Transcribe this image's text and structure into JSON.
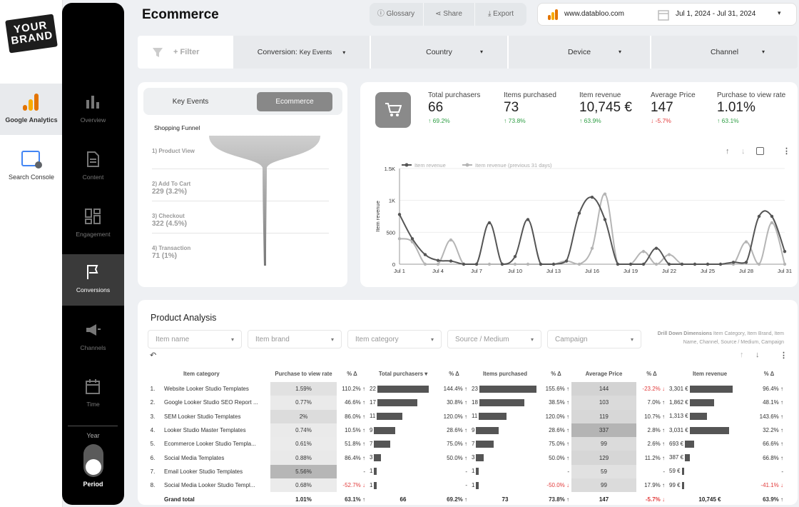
{
  "sources": [
    {
      "label": "Google Analytics",
      "icon": "google-analytics-icon"
    },
    {
      "label": "Search Console",
      "icon": "search-console-icon"
    }
  ],
  "brand": {
    "line1": "YOUR",
    "line2": "BRAND"
  },
  "nav": [
    {
      "label": "Overview",
      "icon": "bar-chart-icon"
    },
    {
      "label": "Content",
      "icon": "document-icon"
    },
    {
      "label": "Engagement",
      "icon": "dashboard-icon"
    },
    {
      "label": "Conversions",
      "icon": "flag-icon"
    },
    {
      "label": "Channels",
      "icon": "megaphone-icon"
    },
    {
      "label": "Time",
      "icon": "calendar-icon"
    }
  ],
  "year_label": "Year",
  "period_label": "Period",
  "page_title": "Ecommerce",
  "toolbar": {
    "glossary": "Glossary",
    "share": "Share",
    "export": "Export"
  },
  "site": "www.databloo.com",
  "date_range": "Jul 1, 2024 - Jul 31, 2024",
  "filters": {
    "add": "+ Filter",
    "conversion": "Conversion:",
    "conversion_value": "Key Events",
    "country": "Country",
    "device": "Device",
    "channel": "Channel"
  },
  "tabs": {
    "key_events": "Key Events",
    "ecommerce": "Ecommerce"
  },
  "funnel": {
    "title": "Shopping Funnel",
    "steps": [
      {
        "label": "1) Product View",
        "value": ""
      },
      {
        "label": "2) Add To Cart",
        "value": "229 (3.2%)"
      },
      {
        "label": "3) Checkout",
        "value": "322 (4.5%)"
      },
      {
        "label": "4) Transaction",
        "value": "71 (1%)"
      }
    ]
  },
  "kpis": [
    {
      "label": "Total purchasers",
      "value": "66",
      "delta": "69.2%",
      "dir": "up"
    },
    {
      "label": "Items purchased",
      "value": "73",
      "delta": "73.8%",
      "dir": "up"
    },
    {
      "label": "Item revenue",
      "value": "10,745 €",
      "delta": "63.9%",
      "dir": "up"
    },
    {
      "label": "Average Price",
      "value": "147",
      "delta": "-5.7%",
      "dir": "down"
    },
    {
      "label": "Purchase to view rate",
      "value": "1.01%",
      "delta": "63.1%",
      "dir": "up"
    }
  ],
  "chart_data": {
    "type": "line",
    "ylabel": "Item revenue",
    "ylim": [
      0,
      1500
    ],
    "yticks": [
      "0",
      "500",
      "1K",
      "1.5K"
    ],
    "xticks": [
      "Jul 1",
      "Jul 4",
      "Jul 7",
      "Jul 10",
      "Jul 13",
      "Jul 16",
      "Jul 19",
      "Jul 22",
      "Jul 25",
      "Jul 28",
      "Jul 31"
    ],
    "x": [
      1,
      2,
      3,
      4,
      5,
      6,
      7,
      8,
      9,
      10,
      11,
      12,
      13,
      14,
      15,
      16,
      17,
      18,
      19,
      20,
      21,
      22,
      23,
      24,
      25,
      26,
      27,
      28,
      29,
      30,
      31
    ],
    "series": [
      {
        "name": "Item revenue",
        "color": "#555555",
        "values": [
          780,
          400,
          150,
          60,
          50,
          0,
          0,
          650,
          0,
          120,
          700,
          0,
          0,
          50,
          800,
          1050,
          700,
          0,
          0,
          0,
          250,
          0,
          0,
          0,
          0,
          0,
          30,
          30,
          750,
          750,
          200
        ]
      },
      {
        "name": "Item revenue (previous 31 days)",
        "color": "#b5b5b5",
        "values": [
          400,
          350,
          0,
          0,
          380,
          0,
          0,
          0,
          0,
          0,
          0,
          0,
          0,
          50,
          0,
          250,
          1100,
          0,
          0,
          200,
          0,
          150,
          0,
          0,
          0,
          0,
          0,
          350,
          0,
          650,
          0
        ]
      }
    ]
  },
  "product": {
    "title": "Product Analysis",
    "dropdowns": [
      "Item name",
      "Item brand",
      "Item category",
      "Source / Medium",
      "Campaign"
    ],
    "note_label": "Drill Down Dimensions",
    "note_value": "Item Category, Item Brand, Item Name, Channel, Source / Medium, Campaign",
    "headers": [
      "",
      "Item category",
      "Purchase to view rate",
      "% Δ",
      "Total purchasers ▾",
      "% Δ",
      "Items purchased",
      "% Δ",
      "Average Price",
      "% Δ",
      "Item revenue",
      "% Δ"
    ],
    "rows": [
      {
        "n": "1.",
        "name": "Website Looker Studio Templates",
        "rate": "1.59%",
        "rd": "110.2% ↑",
        "tp": "22",
        "tpd": "144.4% ↑",
        "ip": "23",
        "ipd": "155.6% ↑",
        "ap": "144",
        "apd": "-23.2% ↓",
        "rev": "3,301 €",
        "revd": "96.4% ↑",
        "tpv": 22,
        "ipv": 23,
        "revv": 3301,
        "ratev": 1.59,
        "apv": 144
      },
      {
        "n": "2.",
        "name": "Google Looker Studio SEO Report ...",
        "rate": "0.77%",
        "rd": "46.6% ↑",
        "tp": "17",
        "tpd": "30.8% ↑",
        "ip": "18",
        "ipd": "38.5% ↑",
        "ap": "103",
        "apd": "7.0% ↑",
        "rev": "1,862 €",
        "revd": "48.1% ↑",
        "tpv": 17,
        "ipv": 18,
        "revv": 1862,
        "ratev": 0.77,
        "apv": 103
      },
      {
        "n": "3.",
        "name": "SEM Looker Studio Templates",
        "rate": "2%",
        "rd": "86.0% ↑",
        "tp": "11",
        "tpd": "120.0% ↑",
        "ip": "11",
        "ipd": "120.0% ↑",
        "ap": "119",
        "apd": "10.7% ↑",
        "rev": "1,313 €",
        "revd": "143.6% ↑",
        "tpv": 11,
        "ipv": 11,
        "revv": 1313,
        "ratev": 2,
        "apv": 119
      },
      {
        "n": "4.",
        "name": "Looker Studio Master Templates",
        "rate": "0.74%",
        "rd": "10.5% ↑",
        "tp": "9",
        "tpd": "28.6% ↑",
        "ip": "9",
        "ipd": "28.6% ↑",
        "ap": "337",
        "apd": "2.8% ↑",
        "rev": "3,031 €",
        "revd": "32.2% ↑",
        "tpv": 9,
        "ipv": 9,
        "revv": 3031,
        "ratev": 0.74,
        "apv": 337
      },
      {
        "n": "5.",
        "name": "Ecommerce Looker Studio Templa...",
        "rate": "0.61%",
        "rd": "51.8% ↑",
        "tp": "7",
        "tpd": "75.0% ↑",
        "ip": "7",
        "ipd": "75.0% ↑",
        "ap": "99",
        "apd": "2.6% ↑",
        "rev": "693 €",
        "revd": "66.6% ↑",
        "tpv": 7,
        "ipv": 7,
        "revv": 693,
        "ratev": 0.61,
        "apv": 99
      },
      {
        "n": "6.",
        "name": "Social Media Templates",
        "rate": "0.88%",
        "rd": "86.4% ↑",
        "tp": "3",
        "tpd": "50.0% ↑",
        "ip": "3",
        "ipd": "50.0% ↑",
        "ap": "129",
        "apd": "11.2% ↑",
        "rev": "387 €",
        "revd": "66.8% ↑",
        "tpv": 3,
        "ipv": 3,
        "revv": 387,
        "ratev": 0.88,
        "apv": 129
      },
      {
        "n": "7.",
        "name": "Email Looker Studio Templates",
        "rate": "5.56%",
        "rd": "-",
        "tp": "1",
        "tpd": "-",
        "ip": "1",
        "ipd": "-",
        "ap": "59",
        "apd": "-",
        "rev": "59 €",
        "revd": "-",
        "tpv": 1,
        "ipv": 1,
        "revv": 59,
        "ratev": 5.56,
        "apv": 59
      },
      {
        "n": "8.",
        "name": "Social Media Looker Studio Templ...",
        "rate": "0.68%",
        "rd": "-52.7% ↓",
        "tp": "1",
        "tpd": "-",
        "ip": "1",
        "ipd": "-50.0% ↓",
        "ap": "99",
        "apd": "17.9% ↑",
        "rev": "99 €",
        "revd": "-41.1% ↓",
        "tpv": 1,
        "ipv": 1,
        "revv": 99,
        "ratev": 0.68,
        "apv": 99
      }
    ],
    "total": {
      "name": "Grand total",
      "rate": "1.01%",
      "rd": "63.1% ↑",
      "tp": "66",
      "tpd": "69.2% ↑",
      "ip": "73",
      "ipd": "73.8% ↑",
      "ap": "147",
      "apd": "-5.7% ↓",
      "rev": "10,745 €",
      "revd": "63.9% ↑"
    }
  }
}
